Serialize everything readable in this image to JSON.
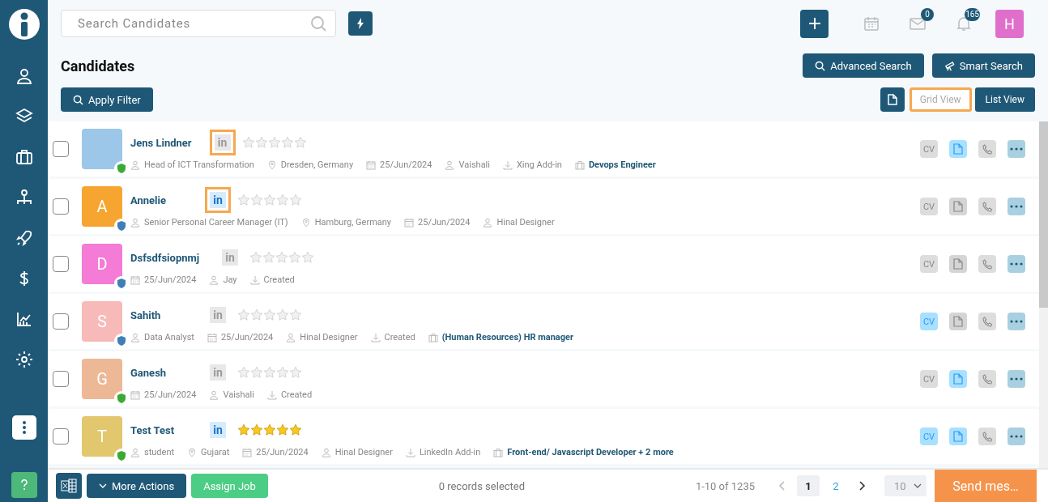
{
  "search": {
    "placeholder": "Search Candidates"
  },
  "header": {
    "mail_count": "0",
    "notification_count": "165",
    "user_initial": "H"
  },
  "page_title": "Candidates",
  "buttons": {
    "advanced_search": "Advanced Search",
    "smart_search": "Smart Search",
    "apply_filter": "Apply Filter"
  },
  "view_toggle": [
    {
      "label": "Grid View",
      "selected": false,
      "highlighted": true
    },
    {
      "label": "List View",
      "selected": true,
      "highlighted": false
    }
  ],
  "candidates": [
    {
      "name": "Jens Lindner",
      "kind": "photo",
      "linkedin_label": "in",
      "cv_label": "CV",
      "color": "#9cc7e8",
      "verified": true,
      "linkedin_active": false,
      "linkedin_highlighted": true,
      "stars": 0,
      "cv": false,
      "document": true,
      "meta": [
        {
          "kind": "title",
          "text": "Head of ICT Transformation"
        },
        {
          "kind": "location",
          "text": "Dresden, Germany"
        },
        {
          "kind": "date",
          "text": "25/Jun/2024"
        },
        {
          "kind": "owner",
          "text": "Vaishali"
        },
        {
          "kind": "source",
          "text": "Xing Add-in"
        },
        {
          "kind": "job",
          "text": "Devops Engineer"
        }
      ],
      "checked": false
    },
    {
      "name": "Annelie",
      "kind": "initial",
      "linkedin_label": "in",
      "cv_label": "CV",
      "initial": "A",
      "color": "#f7a531",
      "verified": false,
      "linkedin_active": true,
      "linkedin_highlighted": true,
      "stars": 0,
      "cv": false,
      "document": false,
      "meta": [
        {
          "kind": "title",
          "text": "Senior Personal Career Manager (IT)"
        },
        {
          "kind": "location",
          "text": "Hamburg, Germany"
        },
        {
          "kind": "date",
          "text": "25/Jun/2024"
        },
        {
          "kind": "owner",
          "text": "Hinal Designer"
        }
      ],
      "checked": false
    },
    {
      "name": "Dsfsdfsiopnmj",
      "kind": "initial",
      "linkedin_label": "in",
      "cv_label": "CV",
      "initial": "D",
      "color": "#f47bd6",
      "verified": false,
      "linkedin_active": false,
      "linkedin_highlighted": false,
      "stars": 0,
      "cv": false,
      "document": false,
      "meta": [
        {
          "kind": "date",
          "text": "25/Jun/2024"
        },
        {
          "kind": "owner",
          "text": "Jay"
        },
        {
          "kind": "source",
          "text": "Created"
        }
      ],
      "checked": false
    },
    {
      "name": "Sahith",
      "kind": "initial",
      "linkedin_label": "in",
      "cv_label": "CV",
      "initial": "S",
      "color": "#f8b9b9",
      "verified": false,
      "linkedin_active": false,
      "linkedin_highlighted": false,
      "stars": 0,
      "cv": true,
      "document": false,
      "meta": [
        {
          "kind": "title",
          "text": "Data Analyst"
        },
        {
          "kind": "date",
          "text": "25/Jun/2024"
        },
        {
          "kind": "owner",
          "text": "Hinal Designer"
        },
        {
          "kind": "source",
          "text": "Created"
        },
        {
          "kind": "job",
          "text": "(Human Resources) HR manager"
        }
      ],
      "checked": false
    },
    {
      "name": "Ganesh",
      "kind": "initial",
      "linkedin_label": "in",
      "cv_label": "CV",
      "initial": "G",
      "color": "#edb896",
      "verified": true,
      "linkedin_active": false,
      "linkedin_highlighted": false,
      "stars": 0,
      "cv": false,
      "document": true,
      "meta": [
        {
          "kind": "date",
          "text": "25/Jun/2024"
        },
        {
          "kind": "owner",
          "text": "Vaishali"
        },
        {
          "kind": "source",
          "text": "Created"
        }
      ],
      "checked": false
    },
    {
      "name": "Test Test",
      "kind": "initial",
      "linkedin_label": "in",
      "cv_label": "CV",
      "initial": "T",
      "color": "#e2c76e",
      "verified": true,
      "linkedin_active": true,
      "linkedin_highlighted": false,
      "stars": 5,
      "cv": true,
      "document": true,
      "meta": [
        {
          "kind": "title",
          "text": "student"
        },
        {
          "kind": "location",
          "text": "Gujarat"
        },
        {
          "kind": "date",
          "text": "25/Jun/2024"
        },
        {
          "kind": "owner",
          "text": "Hinal Designer"
        },
        {
          "kind": "source",
          "text": "LinkedIn Add-in"
        },
        {
          "kind": "job",
          "text": "Front-end/ Javascript Developer + 2 more"
        }
      ],
      "checked": false
    }
  ],
  "footer": {
    "more_actions": "More Actions",
    "assign_job": "Assign Job",
    "selected_count": "0 records selected",
    "range": "1-10 of 1235",
    "pages": [
      {
        "label": "1",
        "selected": true
      },
      {
        "label": "2",
        "selected": false
      }
    ],
    "page_size": "10",
    "send_button": "Send mes…"
  }
}
